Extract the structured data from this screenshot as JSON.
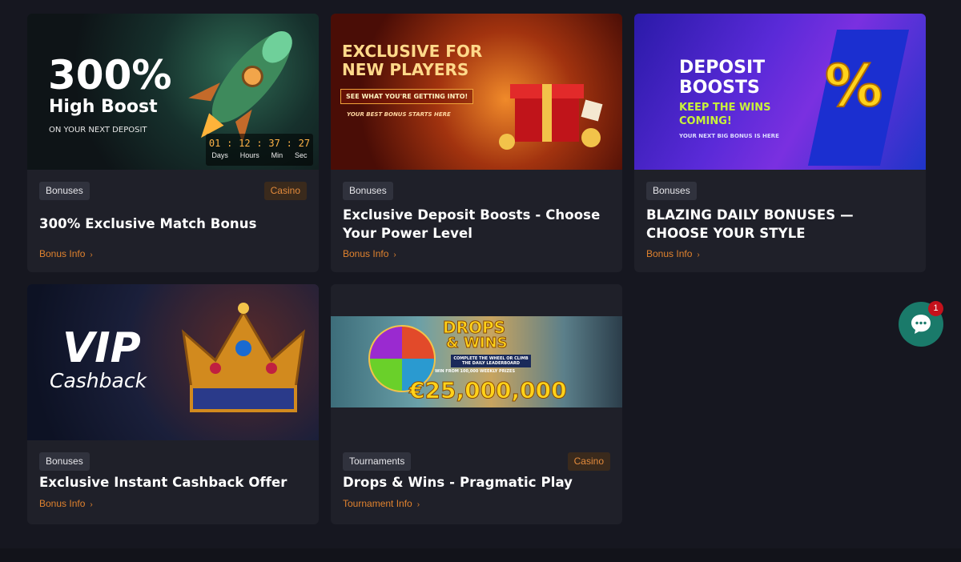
{
  "colors": {
    "accent": "#e0822e",
    "background": "#161720",
    "card": "#1f2029",
    "chat": "#1a7a6a"
  },
  "cards": [
    {
      "banner": {
        "big": "300%",
        "sub": "High Boost",
        "small": "ON YOUR NEXT DEPOSIT",
        "timer": {
          "d": "01",
          "h": "12",
          "m": "37",
          "s": "27",
          "ld": "Days",
          "lh": "Hours",
          "lm": "Min",
          "ls": "Sec"
        }
      },
      "tag": "Bonuses",
      "tag2": "Casino",
      "title": "300% Exclusive Match Bonus",
      "link": "Bonus Info"
    },
    {
      "banner": {
        "line1": "EXCLUSIVE FOR",
        "line2": "NEW PLAYERS",
        "button": "SEE WHAT YOU'RE GETTING INTO!",
        "small": "YOUR BEST BONUS STARTS HERE"
      },
      "tag": "Bonuses",
      "title": "Exclusive Deposit Boosts - Choose Your Power Level",
      "link": "Bonus Info"
    },
    {
      "banner": {
        "line1": "DEPOSIT",
        "line2": "BOOSTS",
        "line3": "KEEP THE WINS",
        "line4": "COMING!",
        "small": "YOUR NEXT BIG BONUS IS HERE",
        "symbol": "%"
      },
      "tag": "Bonuses",
      "title": "BLAZING DAILY BONUSES — CHOOSE YOUR STYLE",
      "link": "Bonus Info"
    },
    {
      "banner": {
        "line1": "VIP",
        "line2": "Cashback"
      },
      "tag": "Bonuses",
      "title": "Exclusive Instant Cashback Offer",
      "link": "Bonus Info"
    },
    {
      "banner": {
        "line1": "DROPS",
        "line2": "& WINS",
        "amount": "€25,000,000",
        "sub": "COMPLETE THE WHEEL OR CLIMB THE DAILY LEADERBOARD",
        "sub2": "WIN FROM 100,000 WEEKLY PRIZES"
      },
      "tag": "Tournaments",
      "tag2": "Casino",
      "title": "Drops & Wins - Pragmatic Play",
      "link": "Tournament Info"
    }
  ],
  "chat": {
    "badge": "1"
  }
}
